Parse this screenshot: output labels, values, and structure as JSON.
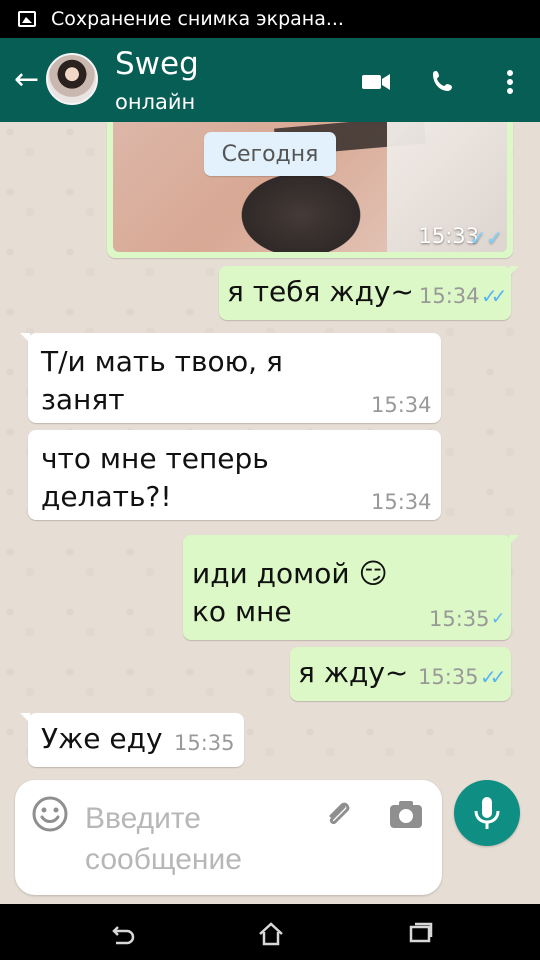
{
  "status_bar": {
    "text": "Сохранение снимка экрана..."
  },
  "header": {
    "contact_name": "Sweg",
    "contact_status": "онлайн"
  },
  "chat": {
    "date_separator": "Сегодня",
    "photo_message": {
      "time": "15:33",
      "status": "read"
    },
    "messages": [
      {
        "direction": "outgoing",
        "text": "я тебя жду~",
        "time": "15:34",
        "status": "read"
      },
      {
        "direction": "incoming",
        "text": "Т/и мать твою, я\nзанят",
        "time": "15:34"
      },
      {
        "direction": "incoming",
        "text": "что мне теперь\nделать?!",
        "time": "15:34"
      },
      {
        "direction": "outgoing",
        "text": "иди домой 😏\nко мне",
        "time": "15:35",
        "status": "sent"
      },
      {
        "direction": "outgoing",
        "text": "я жду~",
        "time": "15:35",
        "status": "read"
      },
      {
        "direction": "incoming",
        "text": "Уже еду",
        "time": "15:35"
      }
    ]
  },
  "composer": {
    "placeholder": "Введите сообщение"
  },
  "icons": {
    "header": [
      "back-arrow-icon",
      "video-call-icon",
      "phone-icon",
      "more-options-icon"
    ],
    "composer": [
      "emoji-icon",
      "attachment-icon",
      "camera-icon",
      "microphone-icon"
    ],
    "navigation": [
      "system-back-icon",
      "system-home-icon",
      "system-recents-icon"
    ]
  },
  "colors": {
    "header": "#075e54",
    "outgoing_bubble": "#dcf8c6",
    "incoming_bubble": "#ffffff",
    "chat_background": "#e6ddd4",
    "mic_button": "#0f8f83",
    "read_ticks": "#57b6f2"
  }
}
